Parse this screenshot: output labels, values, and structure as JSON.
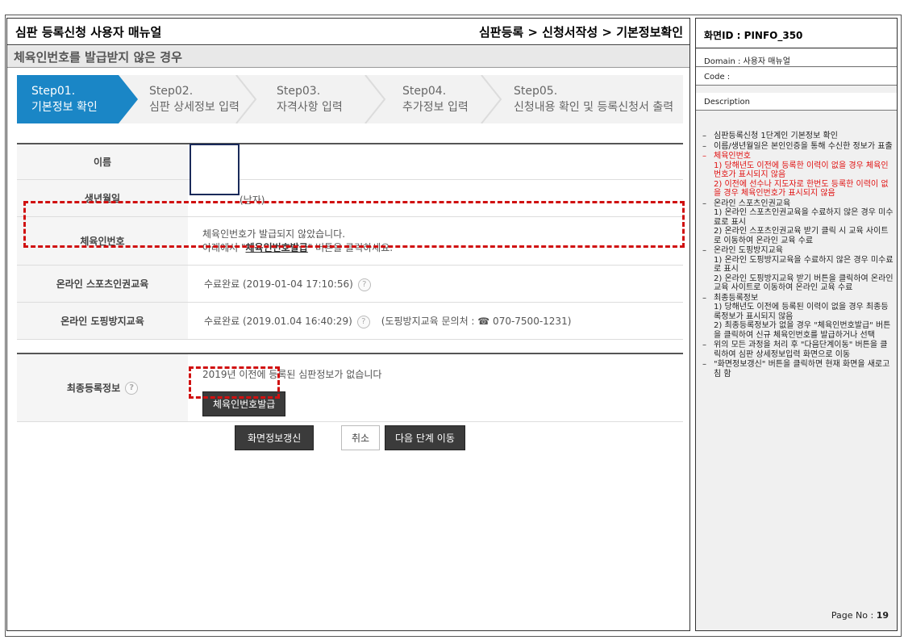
{
  "header": {
    "doc_title": "심판 등록신청 사용자 매뉴얼",
    "breadcrumb": "심판등록 > 신청서작성 > 기본정보확인",
    "sub_title": "체육인번호를 발급받지 않은 경우"
  },
  "steps": [
    {
      "num": "Step01.",
      "label": "기본정보 확인",
      "active": true
    },
    {
      "num": "Step02.",
      "label": "심판 상세정보 입력",
      "active": false
    },
    {
      "num": "Step03.",
      "label": "자격사항 입력",
      "active": false
    },
    {
      "num": "Step04.",
      "label": "추가정보 입력",
      "active": false
    },
    {
      "num": "Step05.",
      "label": "신청내용 확인 및 등록신청서 출력",
      "active": false
    }
  ],
  "form": {
    "name_label": "이름",
    "birth_label": "생년월일",
    "birth_value": "(남자)",
    "sports_id_label": "체육인번호",
    "sports_id_msg1": "체육인번호가 발급되지 않았습니다.",
    "sports_id_msg2_pre": "아래에서 \"",
    "sports_id_msg2_link": "체육인번호발급",
    "sports_id_msg2_post": "\" 버튼을 클릭하세요.",
    "human_rights_label": "온라인 스포츠인권교육",
    "human_rights_value": "수료완료 (2019-01-04 17:10:56)",
    "doping_label": "온라인 도핑방지교육",
    "doping_value": "수료완료 (2019.01.04 16:40:29)",
    "doping_contact": "(도핑방지교육 문의처 : ☎ 070-7500-1231)",
    "last_reg_label": "최종등록정보",
    "last_reg_msg": "2019년 이전에 등록된 심판정보가 없습니다",
    "issue_button": "체육인번호발급",
    "help_glyph": "?"
  },
  "buttons": {
    "refresh": "화면정보갱신",
    "cancel": "취소",
    "next": "다음 단계 이동"
  },
  "info": {
    "screen_id": "화면ID : PINFO_350",
    "domain": "Domain : 사용자 매뉴얼",
    "code": "Code :",
    "description": "Description",
    "page_label": "Page No : ",
    "page_num": "19"
  },
  "description_items": [
    {
      "text": "심판등록신청 1단계인 기본정보 확인",
      "red": false
    },
    {
      "text": "이름/생년월일은 본인인증을 통해 수신한 정보가 표출",
      "red": false
    },
    {
      "text": "체육인번호\n1) 당해년도 이전에 등록한 이력이 없을 경우 체육인번호가 표시되지 않음\n2) 이전에 선수나 지도자로 한번도 등록한 이력이 없을 경우 체육인번호가 표시되지 않음",
      "red": true
    },
    {
      "text": "온라인 스포츠인권교육\n1) 온라인 스포츠인권교육을 수료하지 않은 경우 미수료로 표시\n2) 온라인 스포츠인권교육 받기 클릭 시 교육 사이트로 이동하여 온라인 교육 수료",
      "red": false
    },
    {
      "text": "온라인 도핑방지교육\n1) 온라인 도핑방지교육을 수료하지 않은 경우 미수료로 표시\n2) 온라인 도핑방지교육 받기 버튼을 클릭하여 온라인 교육 사이트로 이동하여 온라인 교육 수료",
      "red": false
    },
    {
      "text": "최종등록정보\n1) 당해년도 이전에 등록된 이력이 없을 경우 최종등록정보가 표시되지 않음\n2) 최종등록정보가 없을 경우 \"체육인번호발급\" 버튼을 클릭하여 신규 체육인번호를 발급하거나 선택",
      "red": false
    },
    {
      "text": "위의 모든 과정을 처리 후 \"다음단계이동\" 버튼을 클릭하여 심판 상세정보입력 화면으로 이동",
      "red": false
    },
    {
      "text": "\"화면정보갱신\" 버튼을 클릭하면 현재 화면을 새로고침 함",
      "red": false
    }
  ],
  "colors": {
    "accent": "#1a86c6",
    "highlight": "#d01010",
    "dark_button": "#3b3b3b"
  }
}
